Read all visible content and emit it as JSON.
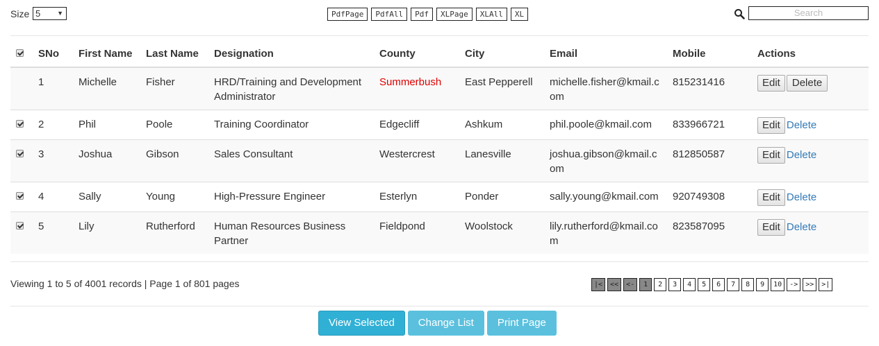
{
  "toolbar": {
    "size_label": "Size",
    "size_value": "5",
    "export_buttons": [
      "PdfPage",
      "PdfAll",
      "Pdf",
      "XLPage",
      "XLAll",
      "XL"
    ],
    "search_placeholder": "Search",
    "search_value": ""
  },
  "table": {
    "headers": [
      "SNo",
      "First Name",
      "Last Name",
      "Designation",
      "County",
      "City",
      "Email",
      "Mobile",
      "Actions"
    ],
    "header_checkbox_checked": true,
    "rows": [
      {
        "checked": false,
        "sno": "1",
        "first": "Michelle",
        "last": "Fisher",
        "designation": "HRD/Training and Development Administrator",
        "county": "Summerbush",
        "county_highlight": true,
        "city": "East Pepperell",
        "email": "michelle.fisher@kmail.com",
        "mobile": "815231416",
        "edit": "Edit",
        "delete": "Delete",
        "delete_style": "button"
      },
      {
        "checked": true,
        "sno": "2",
        "first": "Phil",
        "last": "Poole",
        "designation": "Training Coordinator",
        "county": "Edgecliff",
        "county_highlight": false,
        "city": "Ashkum",
        "email": "phil.poole@kmail.com",
        "mobile": "833966721",
        "edit": "Edit",
        "delete": "Delete",
        "delete_style": "link"
      },
      {
        "checked": true,
        "sno": "3",
        "first": "Joshua",
        "last": "Gibson",
        "designation": "Sales Consultant",
        "county": "Westercrest",
        "county_highlight": false,
        "city": "Lanesville",
        "email": "joshua.gibson@kmail.com",
        "mobile": "812850587",
        "edit": "Edit",
        "delete": "Delete",
        "delete_style": "link"
      },
      {
        "checked": true,
        "sno": "4",
        "first": "Sally",
        "last": "Young",
        "designation": "High-Pressure Engineer",
        "county": "Esterlyn",
        "county_highlight": false,
        "city": "Ponder",
        "email": "sally.young@kmail.com",
        "mobile": "920749308",
        "edit": "Edit",
        "delete": "Delete",
        "delete_style": "link"
      },
      {
        "checked": true,
        "sno": "5",
        "first": "Lily",
        "last": "Rutherford",
        "designation": "Human Resources Business Partner",
        "county": "Fieldpond",
        "county_highlight": false,
        "city": "Woolstock",
        "email": "lily.rutherford@kmail.com",
        "mobile": "823587095",
        "edit": "Edit",
        "delete": "Delete",
        "delete_style": "link"
      }
    ]
  },
  "status_text": "Viewing 1 to 5 of 4001 records | Page 1 of 801 pages",
  "pager": {
    "first": "|<",
    "prev_block": "<<",
    "prev": "<-",
    "pages": [
      "1",
      "2",
      "3",
      "4",
      "5",
      "6",
      "7",
      "8",
      "9",
      "10"
    ],
    "current": "1",
    "next": "->",
    "next_block": ">>",
    "last": ">|"
  },
  "buttons": {
    "view_selected": "View Selected",
    "change_list": "Change List",
    "print_page": "Print Page"
  },
  "colors": {
    "accent": "#5bc0de",
    "accent_dark": "#31b0d5",
    "link": "#337ab7",
    "highlight": "#dd0000"
  }
}
